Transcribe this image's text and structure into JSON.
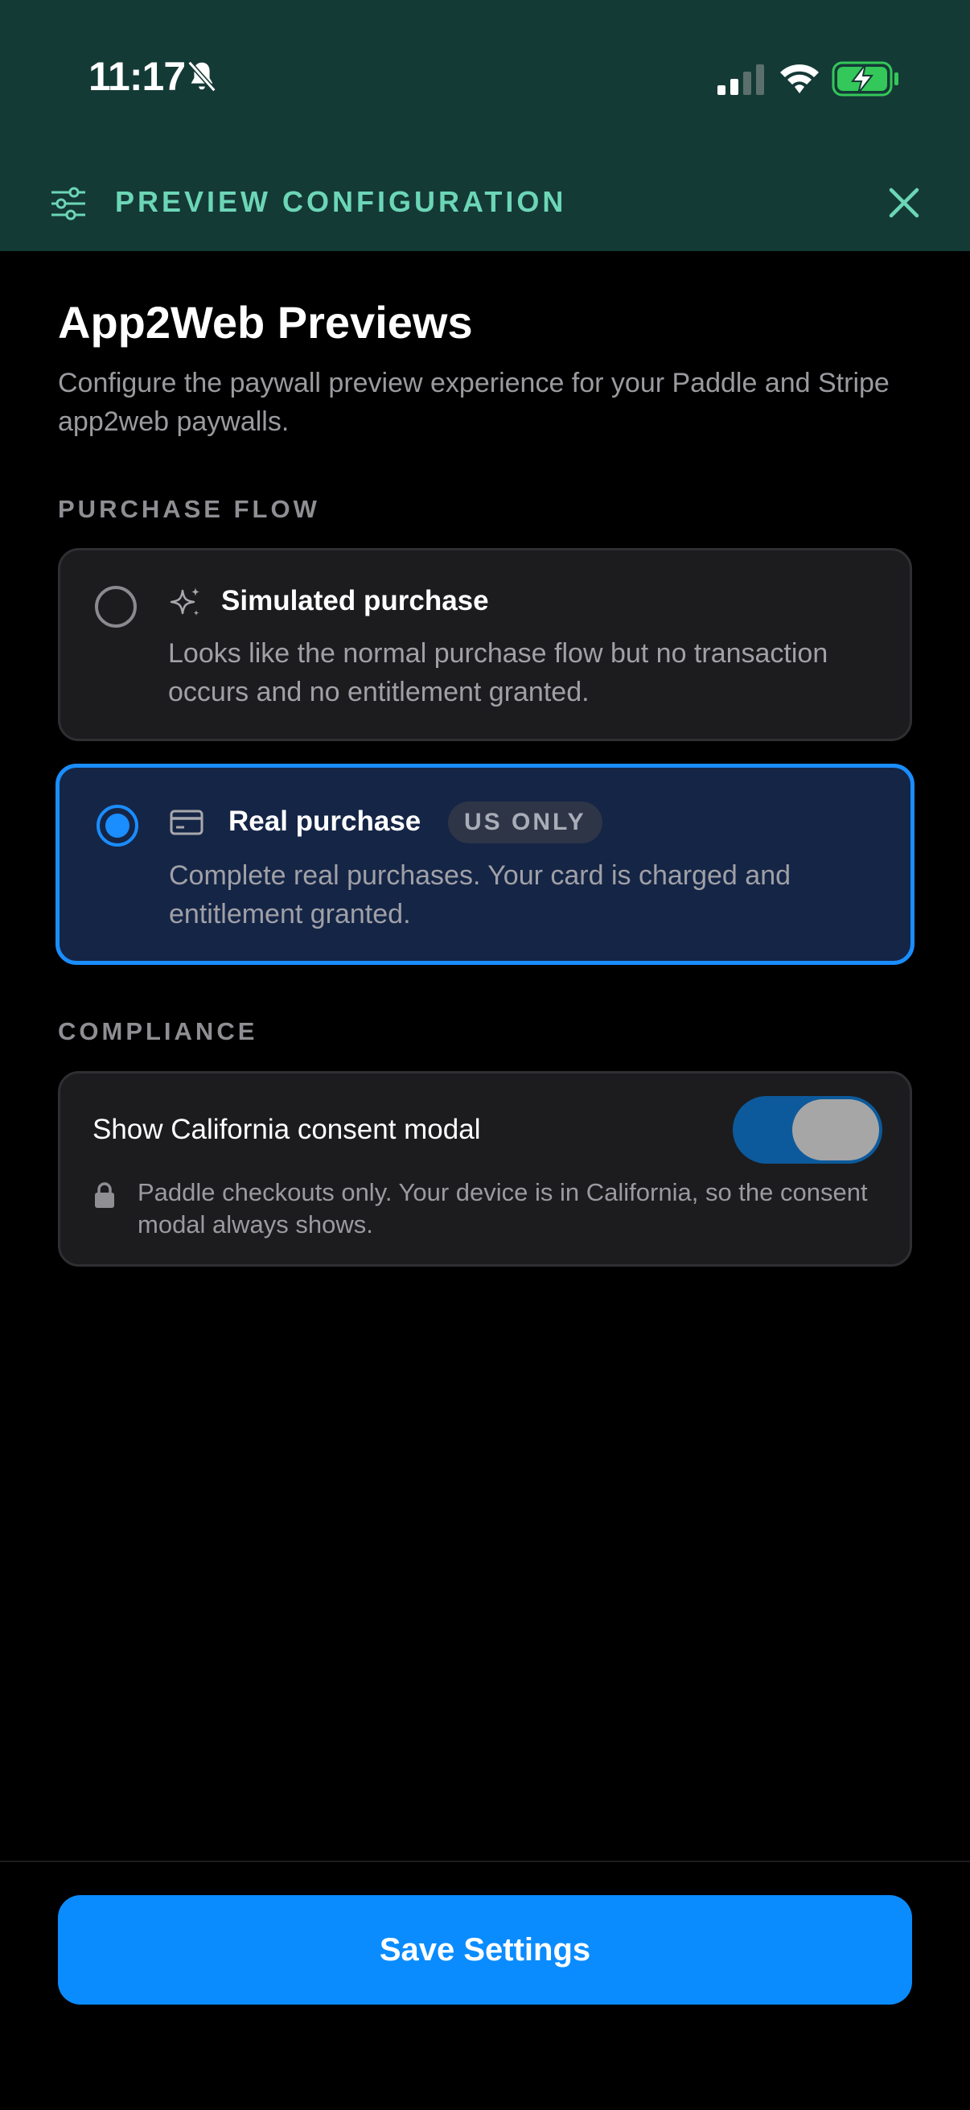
{
  "status_bar": {
    "time": "11:17",
    "icons": [
      "bell-slash-icon",
      "cellular-signal-icon",
      "wifi-icon",
      "battery-charging-icon"
    ],
    "battery_color": "#34c759"
  },
  "header": {
    "icon": "sliders-icon",
    "title": "PREVIEW CONFIGURATION",
    "close_icon": "close-icon",
    "background": "#143a36",
    "accent": "#6cd6b6"
  },
  "page": {
    "title": "App2Web Previews",
    "description": "Configure the paywall preview experience for your Paddle and Stripe app2web paywalls."
  },
  "purchase_flow": {
    "label": "PURCHASE FLOW",
    "selected": "real",
    "options": [
      {
        "id": "simulated",
        "icon": "sparkles-icon",
        "title": "Simulated purchase",
        "description": "Looks like the normal purchase flow but no transaction occurs and no entitlement granted.",
        "selected": false
      },
      {
        "id": "real",
        "icon": "credit-card-icon",
        "title": "Real purchase",
        "badge": "US ONLY",
        "description": "Complete real purchases. Your card is charged and entitlement granted.",
        "selected": true
      }
    ],
    "selected_color": "#1a8dff"
  },
  "compliance": {
    "label": "COMPLIANCE",
    "toggle_label": "Show California consent modal",
    "toggle_on": true,
    "note_icon": "lock-icon",
    "note": "Paddle checkouts only. Your device is in California, so the consent modal always shows."
  },
  "footer": {
    "save_label": "Save Settings",
    "button_color": "#0a8cff"
  }
}
